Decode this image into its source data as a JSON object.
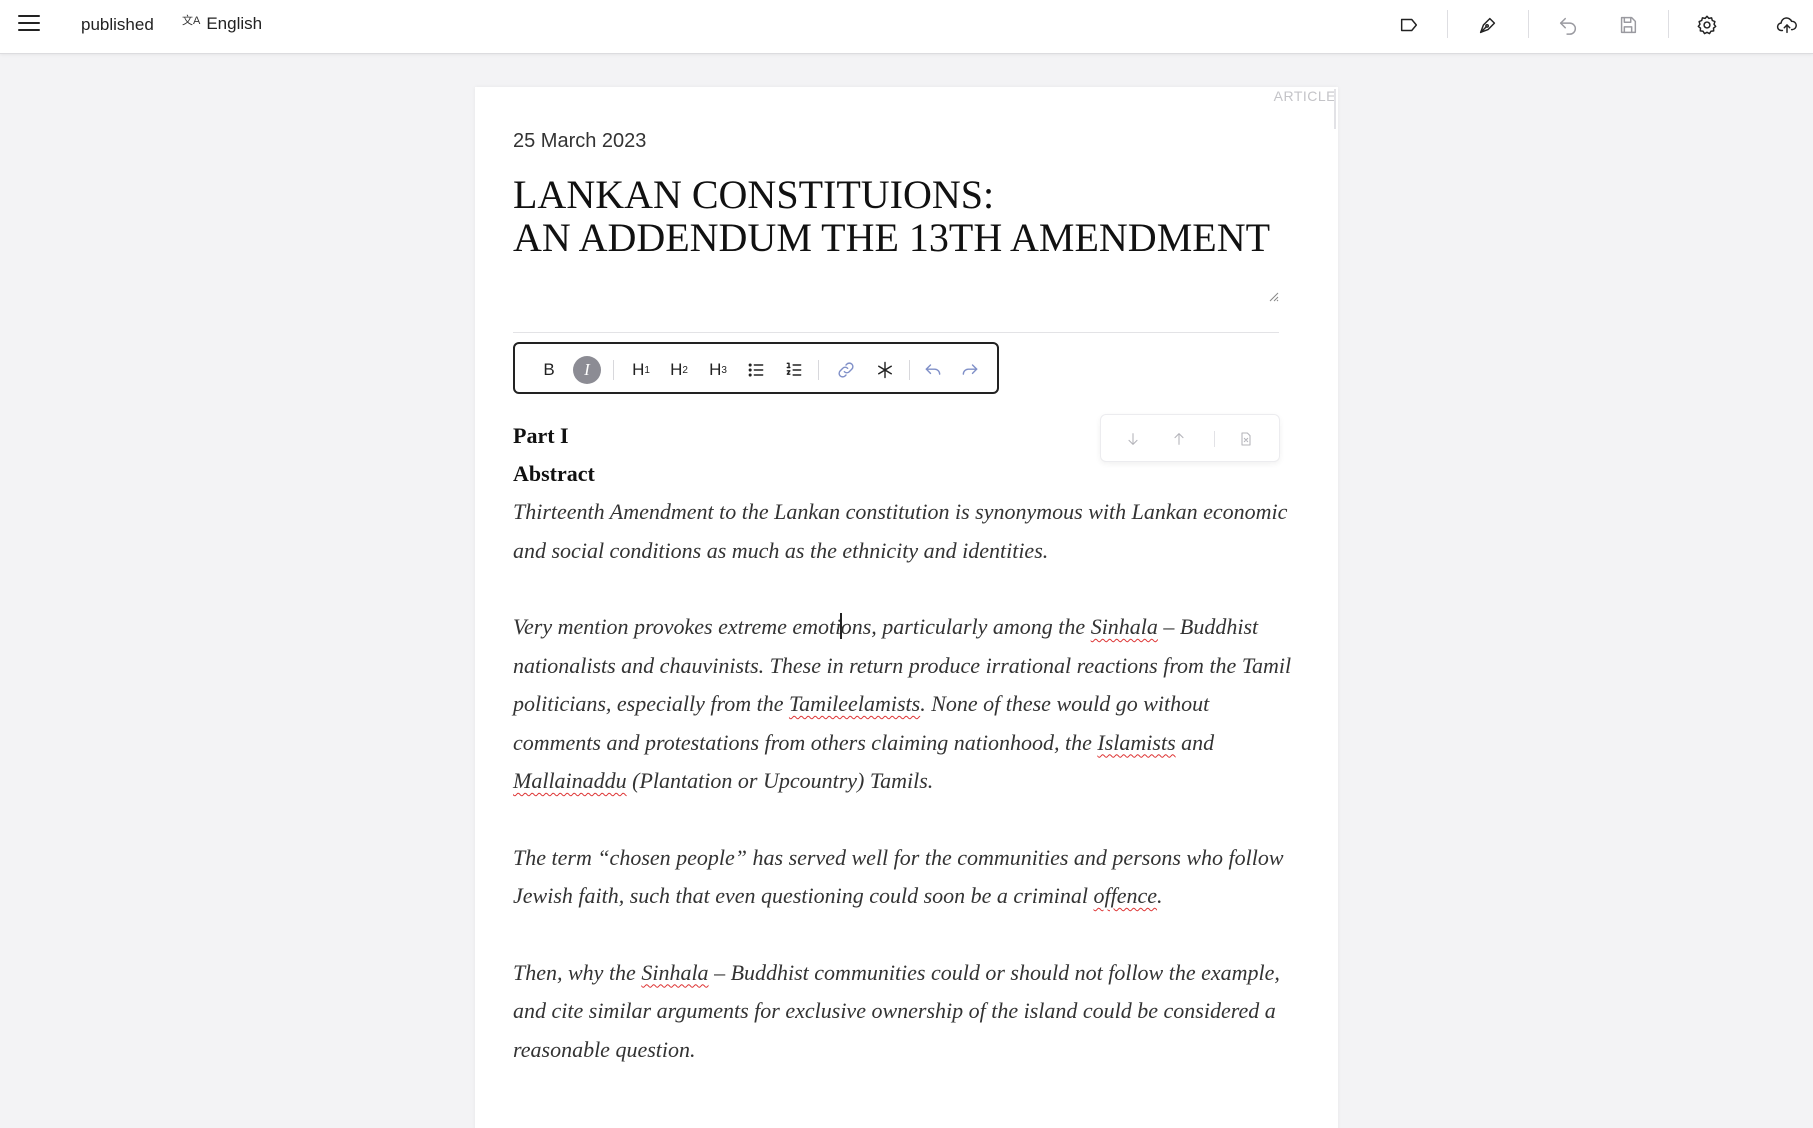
{
  "topbar": {
    "status": "published",
    "language": "English",
    "language_glyph": "文A",
    "icons": [
      "menu-icon",
      "tag-icon",
      "pen-icon",
      "undo-icon",
      "save-icon",
      "gear-icon",
      "cloud-upload-icon"
    ]
  },
  "article": {
    "tag": "ARTICLE",
    "date": "25 March 2023",
    "title_line1": "LANKAN CONSTITUIONS:",
    "title_line2": "AN ADDENDUM THE 13TH AMENDMENT"
  },
  "format_toolbar": {
    "bold": "B",
    "italic": "I",
    "h1": "H",
    "h1_sub": "1",
    "h2": "H",
    "h2_sub": "2",
    "h3": "H",
    "h3_sub": "3",
    "icons": [
      "bullet-list-icon",
      "numbered-list-icon",
      "link-icon",
      "asterisk-icon",
      "undo-icon",
      "redo-icon"
    ]
  },
  "content": {
    "part": "Part I",
    "abstract": "Abstract",
    "p1": "Thirteenth Amendment to the Lankan constitution is synonymous with Lankan economic and social conditions as much as the ethnicity and identities.",
    "p2": {
      "a": "Very mention provokes extreme emoti",
      "b": "ons, particularly among the ",
      "sinhala": "Sinhala",
      "c": " – Buddhist nationalists and chauvinists. These in return produce irrational reactions from the Tamil politicians, especially from the ",
      "tamileelamists": "Tamileelamists",
      "d": ". None of these would go without comments and protestations from others claiming nationhood, the ",
      "islamists": "Islamists",
      "e": " and ",
      "mallainaddu": "Mallainaddu",
      "f": " (Plantation or Upcountry) Tamils."
    },
    "p3": {
      "a": "The term “chosen people” has served well for the communities and persons who follow Jewish faith, such that even questioning could soon be a criminal ",
      "offence": "offence",
      "b": "."
    },
    "p4": {
      "a": "Then, why the ",
      "sinhala": "Sinhala",
      "b": " – Buddhist communities could or should not follow the example, and cite similar arguments for exclusive ownership of the island could be considered a reasonable question."
    }
  }
}
